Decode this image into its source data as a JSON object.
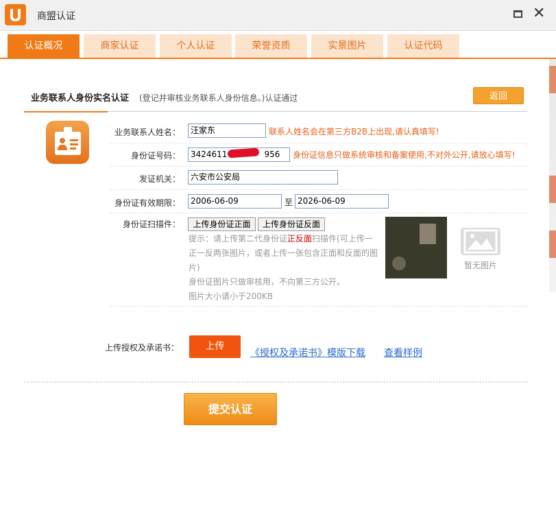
{
  "window": {
    "title": "商盟认证"
  },
  "tabs": [
    {
      "label": "认证概况",
      "active": true
    },
    {
      "label": "商家认证"
    },
    {
      "label": "个人认证"
    },
    {
      "label": "荣誉资质"
    },
    {
      "label": "实景图片"
    },
    {
      "label": "认证代码"
    }
  ],
  "section": {
    "title": "业务联系人身份实名认证",
    "subtitle": "(登记并审核业务联系人身份信息。)认证通过",
    "back_label": "返回"
  },
  "form": {
    "name_label": "业务联系人姓名：",
    "name_value": "汪家东",
    "name_hint": "联系人姓名会在第三方B2B上出现,请认真填写!",
    "id_label": "身份证号码：",
    "id_value_prefix": "3424611",
    "id_value_suffix": "956",
    "id_hint": "身份证信息只做系统审核和备案使用,不对外公开,请放心填写!",
    "authority_label": "发证机关：",
    "authority_value": "六安市公安局",
    "validity_label": "身份证有效期限：",
    "validity_from": "2006-06-09",
    "validity_to_sep": "至",
    "validity_to": "2026-06-09",
    "scan_label": "身份证扫描件：",
    "upload_front_label": "上传身份证正面",
    "upload_back_label": "上传身份证反面",
    "tip_part1": "提示：请上传第二代身份证",
    "tip_highlight": "正反面",
    "tip_part2": "扫描件(可上传一",
    "tip_line2": "正一反两张图片，或者上传一张包含正面和反面的图",
    "tip_line3": "片)",
    "tip_line4": "身份证图片只做审核用，不向第三方公开。",
    "tip_line5": "图片大小请小于200KB",
    "no_image_label": "暂无图片"
  },
  "authorization": {
    "label": "上传授权及承诺书：",
    "upload_label": "上传",
    "template_link": "《授权及承诺书》模版下载",
    "sample_link": "查看样例"
  },
  "submit_label": "提交认证",
  "colors": {
    "accent": "#f07a16",
    "hint": "#e5601a",
    "link": "#2a6bd0"
  }
}
